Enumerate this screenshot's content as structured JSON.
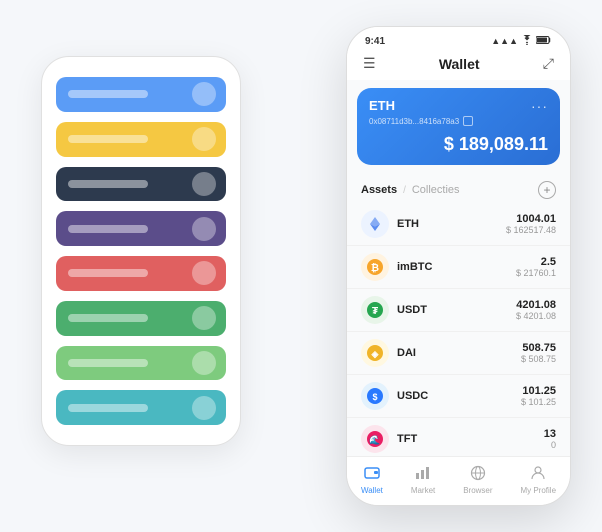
{
  "scene": {
    "bg_phone": {
      "cards": [
        {
          "id": "blue",
          "color": "card-blue",
          "icon_text": ""
        },
        {
          "id": "yellow",
          "color": "card-yellow",
          "icon_text": ""
        },
        {
          "id": "dark",
          "color": "card-dark",
          "icon_text": ""
        },
        {
          "id": "purple",
          "color": "card-purple",
          "icon_text": ""
        },
        {
          "id": "red",
          "color": "card-red",
          "icon_text": ""
        },
        {
          "id": "green",
          "color": "card-green",
          "icon_text": ""
        },
        {
          "id": "lightgreen",
          "color": "card-lightgreen",
          "icon_text": ""
        },
        {
          "id": "teal",
          "color": "card-teal",
          "icon_text": ""
        }
      ]
    },
    "fg_phone": {
      "status_bar": {
        "time": "9:41",
        "signal": "●●●",
        "wifi": "wifi",
        "battery": "battery"
      },
      "top_nav": {
        "hamburger": "☰",
        "title": "Wallet",
        "expand": "⤢"
      },
      "eth_card": {
        "label": "ETH",
        "dots": "···",
        "address": "0x08711d3b...8416a78a3",
        "copy_icon": "□",
        "balance_prefix": "$",
        "balance": "189,089.11"
      },
      "assets_section": {
        "tab_active": "Assets",
        "tab_divider": "/",
        "tab_inactive": "Collecties",
        "add_icon": "+"
      },
      "asset_list": [
        {
          "id": "eth",
          "icon": "◈",
          "icon_class": "icon-eth",
          "name": "ETH",
          "amount": "1004.01",
          "usd": "$ 162517.48"
        },
        {
          "id": "imbtc",
          "icon": "ⓘ",
          "icon_class": "icon-imbtc",
          "name": "imBTC",
          "amount": "2.5",
          "usd": "$ 21760.1"
        },
        {
          "id": "usdt",
          "icon": "T",
          "icon_class": "icon-usdt",
          "name": "USDT",
          "amount": "4201.08",
          "usd": "$ 4201.08"
        },
        {
          "id": "dai",
          "icon": "◉",
          "icon_class": "icon-dai",
          "name": "DAI",
          "amount": "508.75",
          "usd": "$ 508.75"
        },
        {
          "id": "usdc",
          "icon": "$",
          "icon_class": "icon-usdc",
          "name": "USDC",
          "amount": "101.25",
          "usd": "$ 101.25"
        },
        {
          "id": "tft",
          "icon": "🌊",
          "icon_class": "icon-tft",
          "name": "TFT",
          "amount": "13",
          "usd": "0"
        }
      ],
      "bottom_nav": [
        {
          "id": "wallet",
          "icon": "◎",
          "label": "Wallet",
          "active": true
        },
        {
          "id": "market",
          "icon": "📊",
          "label": "Market",
          "active": false
        },
        {
          "id": "browser",
          "icon": "🌐",
          "label": "Browser",
          "active": false
        },
        {
          "id": "profile",
          "icon": "👤",
          "label": "My Profile",
          "active": false
        }
      ]
    }
  }
}
